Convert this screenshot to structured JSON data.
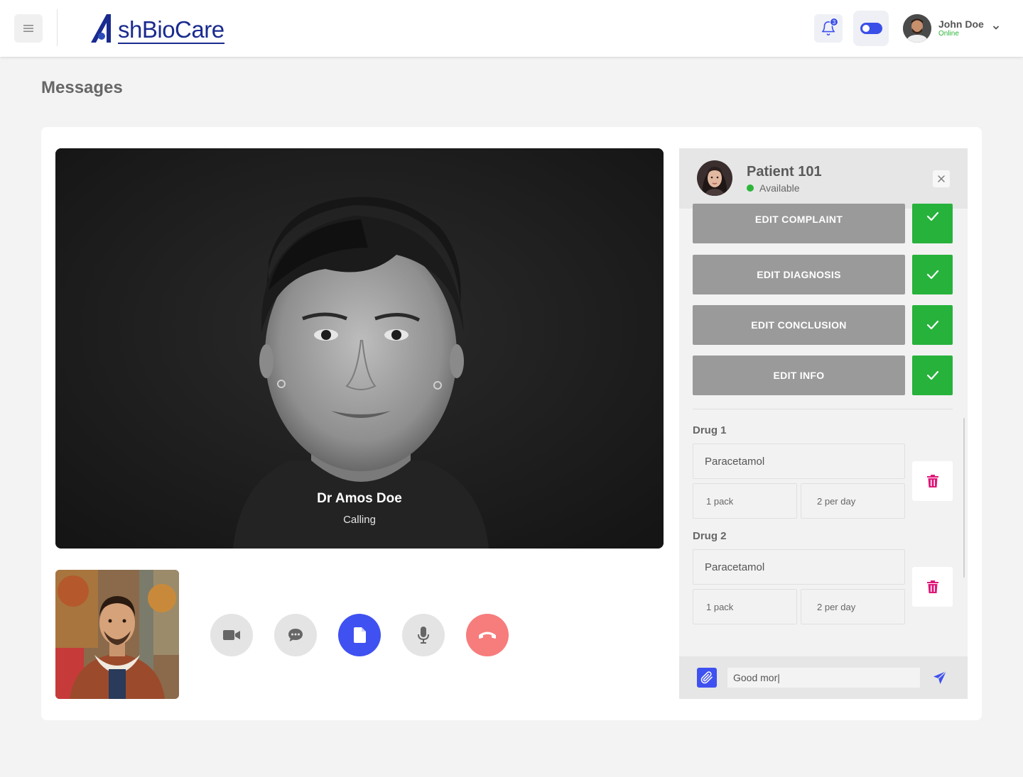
{
  "header": {
    "logo_text": "shBioCare",
    "notification_count": "3",
    "user": {
      "name": "John Doe",
      "status": "Online"
    }
  },
  "page": {
    "title": "Messages"
  },
  "call": {
    "caller_name": "Dr Amos Doe",
    "caller_status": "Calling"
  },
  "controls": [
    {
      "name": "camera-button",
      "icon": "video-camera-icon"
    },
    {
      "name": "chat-button",
      "icon": "chat-bubble-icon"
    },
    {
      "name": "document-button",
      "icon": "file-icon"
    },
    {
      "name": "mic-button",
      "icon": "microphone-icon"
    },
    {
      "name": "hangup-button",
      "icon": "phone-hangup-icon"
    }
  ],
  "panel": {
    "patient_name": "Patient 101",
    "patient_status": "Available",
    "actions": [
      {
        "label": "EDIT COMPLAINT"
      },
      {
        "label": "EDIT DIAGNOSIS"
      },
      {
        "label": "EDIT CONCLUSION"
      },
      {
        "label": "EDIT INFO"
      }
    ],
    "drugs": [
      {
        "label": "Drug 1",
        "name": "Paracetamol",
        "quantity": "1 pack",
        "frequency": "2 per day"
      },
      {
        "label": "Drug 2",
        "name": "Paracetamol",
        "quantity": "1 pack",
        "frequency": "2 per day"
      }
    ],
    "chat_input_value": "Good mor|"
  },
  "colors": {
    "accent": "#3f51f0",
    "success": "#27b23c",
    "danger": "#f77c7c",
    "trash": "#e0177a",
    "brand": "#1a2b8f"
  }
}
